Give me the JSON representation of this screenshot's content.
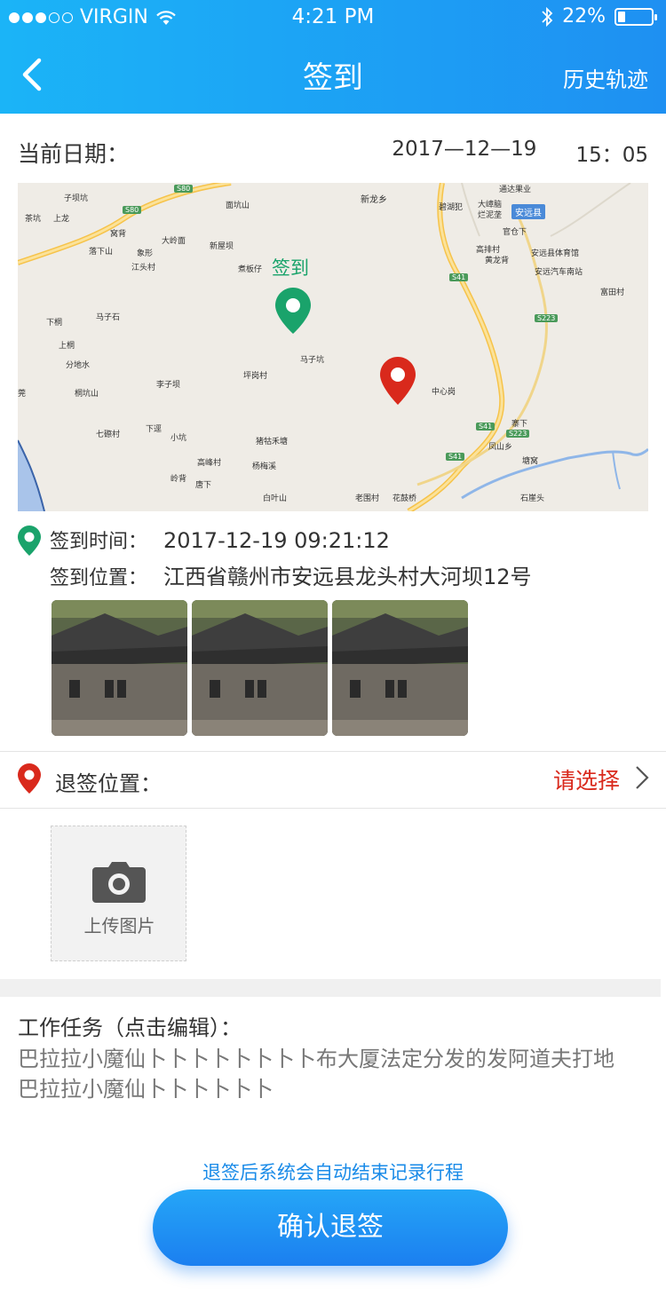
{
  "status_bar": {
    "carrier": "VIRGIN",
    "time": "4:21 PM",
    "battery": "22%",
    "battery_level": 0.22,
    "signal_bars_filled": 3,
    "signal_bars_total": 5
  },
  "nav": {
    "title": "签到",
    "right_action": "历史轨迹"
  },
  "date": {
    "label": "当前日期：",
    "date": "2017—12—19",
    "time": "15：05"
  },
  "map": {
    "checkin_marker_label": "签到",
    "labels": [
      "子坝坑",
      "茶坑",
      "上龙",
      "面坑山",
      "新龙乡",
      "通达果业",
      "大嶂脑",
      "烂泥垄",
      "安远县",
      "碧湖犯",
      "高排村",
      "黄龙背",
      "安远县体育馆",
      "官仓下",
      "安远汽车南站",
      "窝背",
      "落下山",
      "大岭面",
      "象形",
      "新屋坝",
      "江头村",
      "煮板仔",
      "富田村",
      "下桐",
      "马子石",
      "上桐",
      "马子坑",
      "分地水",
      "桐坑山",
      "李子坝",
      "坪岗村",
      "中心岗",
      "七磜村",
      "下逕",
      "小坑",
      "猪牯禾塘",
      "寨下",
      "凤山乡",
      "高峰村",
      "杨梅溪",
      "岭背",
      "唐下",
      "塘窝",
      "白叶山",
      "老围村",
      "花鼓桥",
      "石崖头",
      "莞"
    ],
    "road_badges": [
      "S80",
      "S80",
      "S41",
      "S223",
      "S41",
      "S223",
      "S41"
    ],
    "county_badge": "安远县"
  },
  "checkin": {
    "time_label": "签到时间：",
    "time_value": "2017-12-19 09:21:12",
    "location_label": "签到位置：",
    "location_value": "江西省赣州市安远县龙头村大河坝12号"
  },
  "checkout": {
    "label": "退签位置：",
    "select_text": "请选择"
  },
  "upload": {
    "label": "上传图片"
  },
  "task": {
    "title": "工作任务（点击编辑）：",
    "line1": "巴拉拉小魔仙卜卜卜卜卜卜卜卜布大厦法定分发的发阿道夫打地",
    "line2": "巴拉拉小魔仙卜卜卜卜卜卜"
  },
  "footer": {
    "hint": "退签后系统会自动结束记录行程",
    "confirm_button": "确认退签"
  },
  "colors": {
    "primary": "#1e90f2",
    "accent_red": "#d9291c",
    "accent_green": "#1aa36b"
  },
  "icons": [
    "back-chevron-icon",
    "wifi-icon",
    "bluetooth-icon",
    "battery-icon",
    "location-pin-green-icon",
    "location-pin-red-icon",
    "chevron-right-icon",
    "camera-icon"
  ]
}
